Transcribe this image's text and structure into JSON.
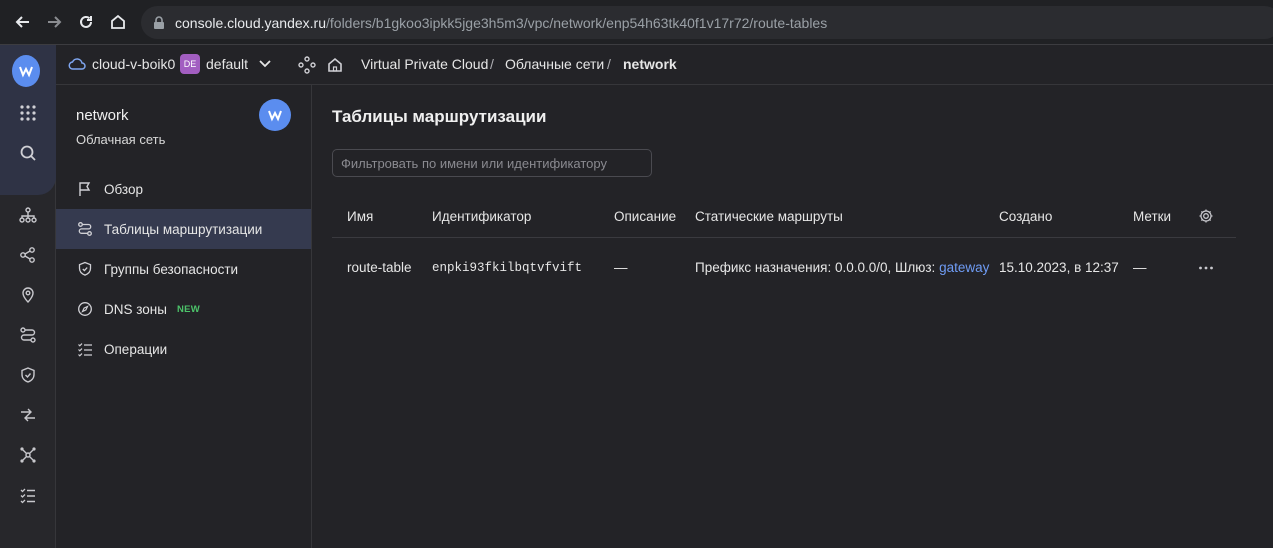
{
  "browser": {
    "url_host": "console.cloud.yandex.ru",
    "url_path": "/folders/b1gkoo3ipkk5jge3h5m3/vpc/network/enp54h63tk40f1v17r72/route-tables"
  },
  "header": {
    "cloud_name": "cloud-v-boik0",
    "folder_badge": "DE",
    "folder_name": "default",
    "breadcrumb": [
      "Virtual Private Cloud",
      "/",
      "Облачные сети",
      "/",
      "network"
    ]
  },
  "sidebar": {
    "title": "network",
    "subtitle": "Облачная сеть",
    "items": [
      {
        "label": "Обзор",
        "icon": "flag-icon"
      },
      {
        "label": "Таблицы маршрутизации",
        "icon": "route-icon",
        "active": true
      },
      {
        "label": "Группы безопасности",
        "icon": "shield-icon"
      },
      {
        "label": "DNS зоны",
        "icon": "compass-icon",
        "badge": "NEW"
      },
      {
        "label": "Операции",
        "icon": "list-check-icon"
      }
    ]
  },
  "main": {
    "title": "Таблицы маршрутизации",
    "filter_placeholder": "Фильтровать по имени или идентификатору",
    "columns": [
      "Имя",
      "Идентификатор",
      "Описание",
      "Статические маршруты",
      "Создано",
      "Метки"
    ],
    "rows": [
      {
        "name": "route-table",
        "id": "enpki93fkilbqtvfvift",
        "description": "—",
        "routes_prefix": "Префикс назначения: 0.0.0.0/0, Шлюз:",
        "routes_gateway": "gateway",
        "created": "15.10.2023, в 12:37",
        "labels": "—"
      }
    ]
  },
  "colors": {
    "accent": "#5b8def",
    "active_bg": "#353a4f",
    "new_badge": "#4cc36a",
    "link": "#6f9cf5"
  }
}
